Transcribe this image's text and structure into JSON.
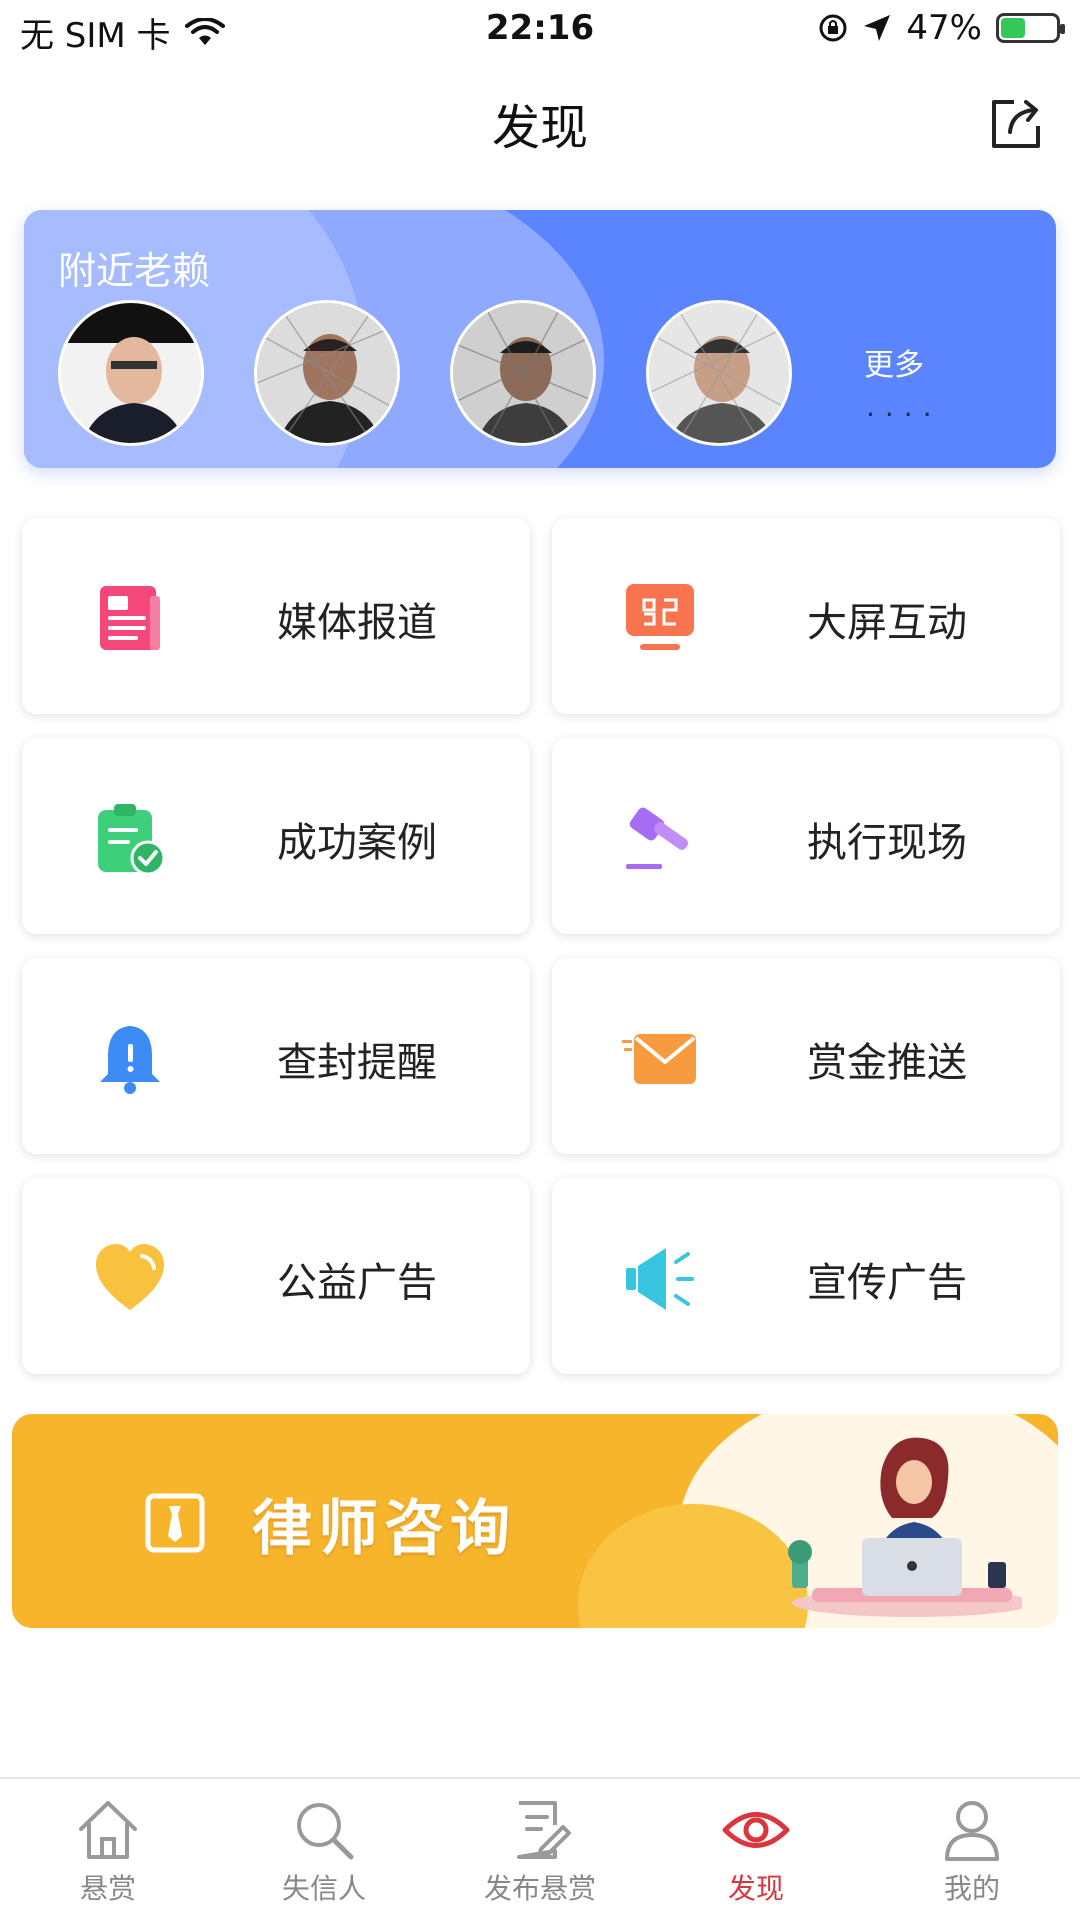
{
  "status_bar": {
    "carrier": "无 SIM 卡",
    "time": "22:16",
    "battery_percent": "47%",
    "battery_level": 0.47
  },
  "nav": {
    "title": "发现"
  },
  "banner": {
    "title": "附近老赖",
    "more_label": "更多",
    "more_dots": "....",
    "avatar_count": 4
  },
  "grid": [
    {
      "label": "媒体报道",
      "icon": "newspaper-icon",
      "color": "#f5487a"
    },
    {
      "label": "大屏互动",
      "icon": "screen-icon",
      "color": "#f8744f"
    },
    {
      "label": "成功案例",
      "icon": "clipboard-check-icon",
      "color": "#3ecf7a"
    },
    {
      "label": "执行现场",
      "icon": "gavel-icon",
      "color": "#a86bf5"
    },
    {
      "label": "查封提醒",
      "icon": "bell-icon",
      "color": "#3d8cf5"
    },
    {
      "label": "赏金推送",
      "icon": "mail-icon",
      "color": "#f89a3e"
    },
    {
      "label": "公益广告",
      "icon": "heart-icon",
      "color": "#f8c23e"
    },
    {
      "label": "宣传广告",
      "icon": "megaphone-icon",
      "color": "#38c5e0"
    }
  ],
  "lawyer_banner": {
    "text": "律师咨询"
  },
  "tabs": [
    {
      "label": "悬赏",
      "icon": "home-icon"
    },
    {
      "label": "失信人",
      "icon": "search-icon"
    },
    {
      "label": "发布悬赏",
      "icon": "edit-document-icon"
    },
    {
      "label": "发现",
      "icon": "eye-icon",
      "active": true
    },
    {
      "label": "我的",
      "icon": "user-icon"
    }
  ],
  "colors": {
    "banner_blue": "#5b84ff",
    "tab_active": "#d9363e",
    "tab_inactive": "#888888",
    "lawyer_orange": "#f7b52c"
  }
}
